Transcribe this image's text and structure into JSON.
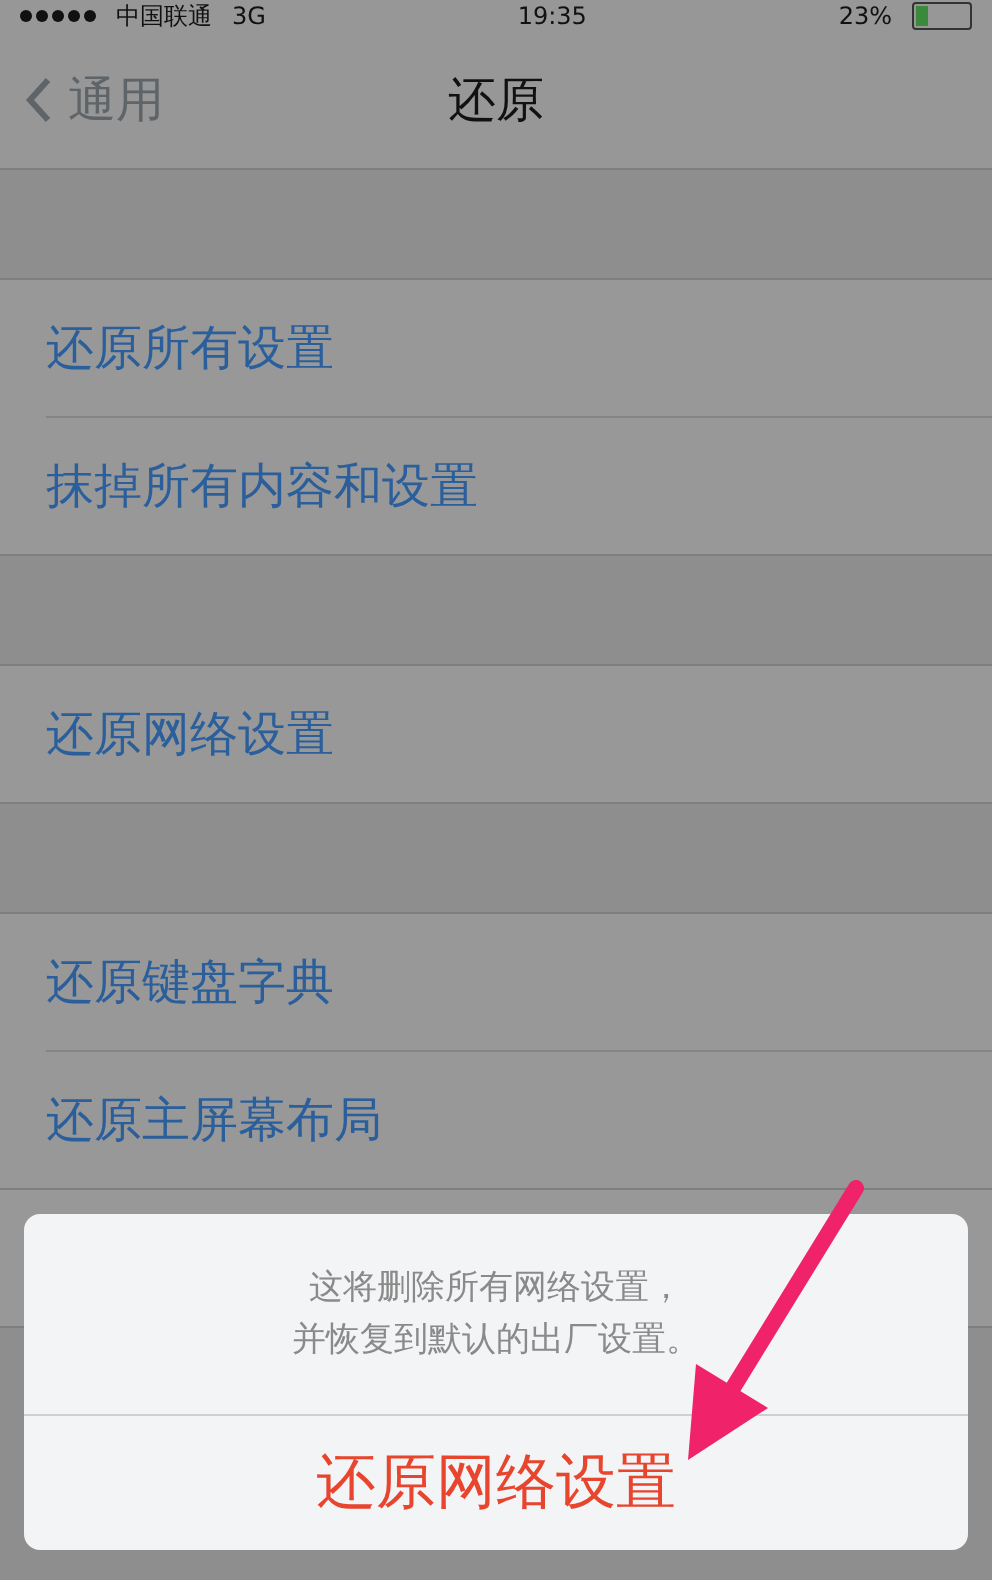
{
  "status_bar": {
    "carrier": "中国联通",
    "network": "3G",
    "time": "19:35",
    "battery": "23%"
  },
  "nav": {
    "back": "通用",
    "title": "还原"
  },
  "sections": [
    {
      "rows": [
        "还原所有设置",
        "抹掉所有内容和设置"
      ]
    },
    {
      "rows": [
        "还原网络设置"
      ]
    },
    {
      "rows": [
        "还原键盘字典",
        "还原主屏幕布局"
      ]
    }
  ],
  "action_sheet": {
    "message": [
      "这将删除所有网络设置，",
      "并恢复到默认的出厂设置。"
    ],
    "button": "还原网络设置"
  }
}
